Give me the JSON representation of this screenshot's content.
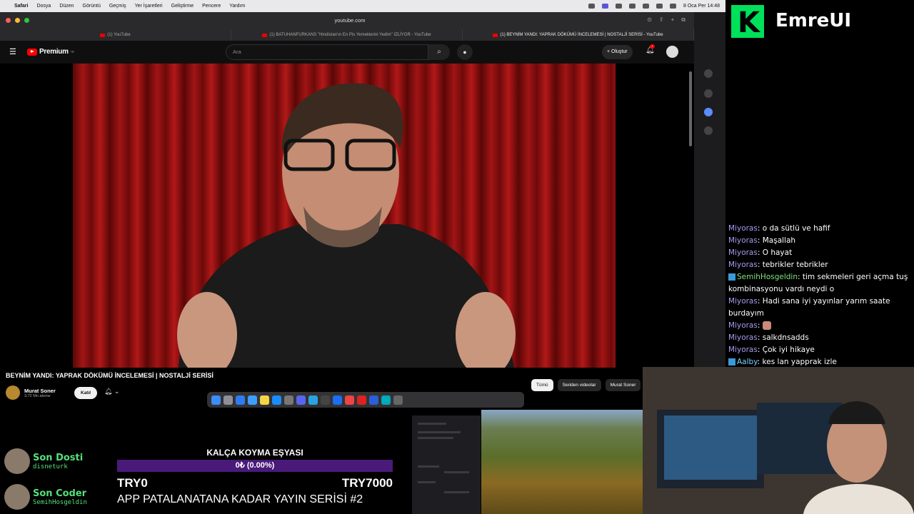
{
  "menubar": {
    "app": "Safari",
    "items": [
      "Dosya",
      "Düzen",
      "Görüntü",
      "Geçmiş",
      "Yer İşaretleri",
      "Geliştirme",
      "Pencere",
      "Yardım"
    ],
    "clock": "8 Oca Per  14:48"
  },
  "browser": {
    "url": "youtube.com",
    "tabs": [
      {
        "label": "(1) YouTube"
      },
      {
        "label": "(1) BATUHANFURKANS \"Hindistan'ın En Pis Yemeklerini Yedim\" İZLİYOR - YouTube"
      },
      {
        "label": "(1) BEYNİM YANDI: YAPRAK DÖKÜMÜ İNCELEMESİ | NOSTALJİ SERİSİ - YouTube"
      }
    ]
  },
  "youtube": {
    "logo": "Premium",
    "logo_region": "TR",
    "search_placeholder": "Ara",
    "create_label": "+ Oluştur",
    "notif_count": "1",
    "video_title": "BEYNİM YANDI: YAPRAK DÖKÜMÜ İNCELEMESİ | NOSTALJİ SERİSİ",
    "channel_name": "Murat Soner",
    "channel_subs": "3,72 Mn abone",
    "join_label": "Katıl",
    "chips": [
      "Tümü",
      "Seriden videolar",
      "Murat Soner"
    ]
  },
  "brand": {
    "name": "EmreUI"
  },
  "chat": [
    {
      "user": "Miyoras",
      "text": "o da sütlü ve hafif",
      "color": "purple"
    },
    {
      "user": "Miyoras",
      "text": "Maşallah",
      "color": "purple"
    },
    {
      "user": "Miyoras",
      "text": "O hayat",
      "color": "purple"
    },
    {
      "user": "Miyoras",
      "text": "tebrikler tebrikler",
      "color": "purple"
    },
    {
      "user": "SemihHosgeldin",
      "text": "tim sekmeleri geri açma tuş kombinasyonu vardı neydi o",
      "color": "green"
    },
    {
      "user": "Miyoras",
      "text": "Hadi sana iyi yayınlar yarım saate burdayım",
      "color": "purple"
    },
    {
      "user": "Miyoras",
      "text": "",
      "color": "purple"
    },
    {
      "user": "Miyoras",
      "text": "salkdnsadds",
      "color": "purple"
    },
    {
      "user": "Miyoras",
      "text": "Çok iyi hikaye",
      "color": "purple"
    },
    {
      "user": "Aalby",
      "text": "kes lan yapprak izle",
      "color": "blue"
    }
  ],
  "donors": [
    {
      "label": "Son Dosti",
      "name": "disneturk"
    },
    {
      "label": "Son Coder",
      "name": "SemihHosgeldin"
    }
  ],
  "goal": {
    "heading": "KALÇA KOYMA EŞYASI",
    "progress_text": "0₺ (0.00%)",
    "progress": 0.0,
    "min": "TRY0",
    "max": "TRY7000",
    "series": "APP PATALANATANA KADAR YAYIN SERİSİ #2"
  }
}
